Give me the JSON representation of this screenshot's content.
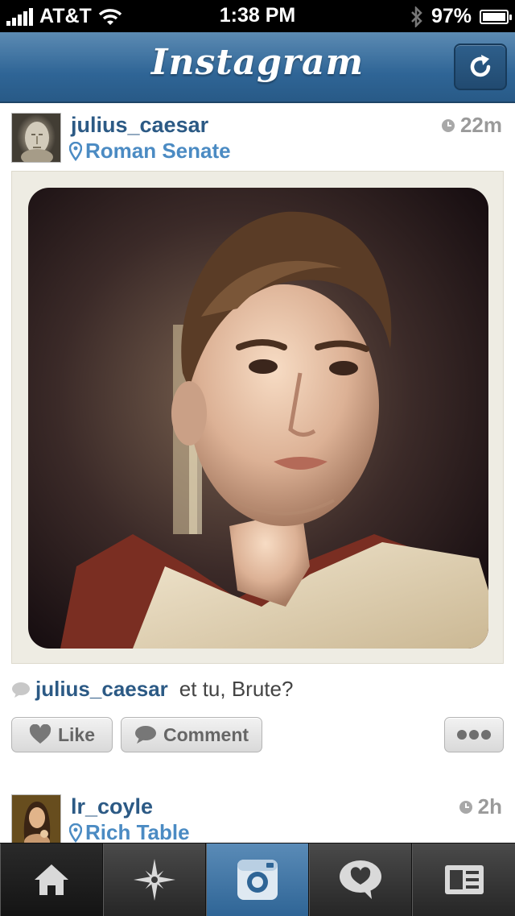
{
  "status_bar": {
    "carrier": "AT&T",
    "time": "1:38 PM",
    "battery": "97%"
  },
  "header": {
    "title": "Instagram"
  },
  "posts": [
    {
      "username": "julius_caesar",
      "location": "Roman Senate",
      "time_ago": "22m",
      "caption_user": "julius_caesar",
      "caption": "et tu, Brute?"
    },
    {
      "username": "lr_coyle",
      "location": "Rich Table",
      "time_ago": "2h"
    }
  ],
  "actions": {
    "like": "Like",
    "comment": "Comment"
  },
  "tabs": [
    {
      "icon": "home-icon"
    },
    {
      "icon": "explore-star-icon"
    },
    {
      "icon": "camera-icon"
    },
    {
      "icon": "heart-bubble-icon"
    },
    {
      "icon": "profile-card-icon"
    }
  ],
  "colors": {
    "nav_blue": "#2f6596",
    "username": "#2c5a85",
    "location": "#4b8bc3"
  }
}
